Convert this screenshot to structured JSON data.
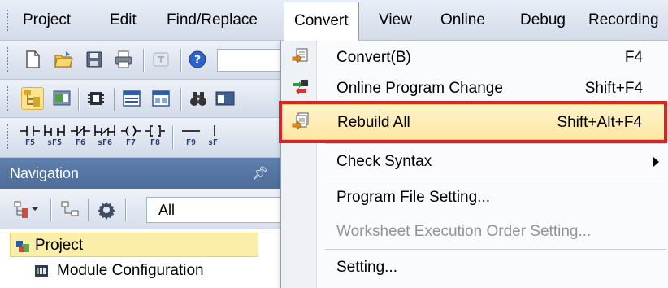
{
  "menubar": {
    "items": [
      {
        "label": "Project"
      },
      {
        "label": "Edit"
      },
      {
        "label": "Find/Replace"
      },
      {
        "label": "Convert"
      },
      {
        "label": "View"
      },
      {
        "label": "Online"
      },
      {
        "label": "Debug"
      },
      {
        "label": "Recording"
      }
    ],
    "open_item": "Convert"
  },
  "toolbar3": {
    "keys": [
      {
        "label": "F5",
        "icon": "open-contact-icon"
      },
      {
        "label": "sF5",
        "icon": "parallel-open-contact-icon"
      },
      {
        "label": "F6",
        "icon": "closed-contact-icon"
      },
      {
        "label": "sF6",
        "icon": "parallel-closed-contact-icon"
      },
      {
        "label": "F7",
        "icon": "coil-icon"
      },
      {
        "label": "F8",
        "icon": "application-instruction-icon"
      },
      {
        "label": "F9",
        "icon": "horizontal-line-icon"
      },
      {
        "label": "sF",
        "icon": "vertical-line-icon"
      }
    ]
  },
  "navigation": {
    "title": "Navigation",
    "filter_value": "All",
    "tree": [
      {
        "label": "Project",
        "icon": "project-folder-icon"
      },
      {
        "label": "Module Configuration",
        "icon": "module-configuration-icon"
      }
    ]
  },
  "convert_menu": {
    "items": [
      {
        "label": "Convert(B)",
        "shortcut": "F4",
        "icon": "convert-icon"
      },
      {
        "label": "Online Program Change",
        "shortcut": "Shift+F4",
        "icon": "online-program-change-icon"
      },
      {
        "label": "Rebuild All",
        "shortcut": "Shift+Alt+F4",
        "icon": "rebuild-all-icon"
      },
      {
        "label": "Check Syntax"
      },
      {
        "label": "Program File Setting..."
      },
      {
        "label": "Worksheet Execution Order Setting..."
      },
      {
        "label": "Setting..."
      }
    ]
  },
  "colors": {
    "highlight": "#fde7a3",
    "callout": "#d9232a",
    "nav_header": "#5474a3"
  }
}
